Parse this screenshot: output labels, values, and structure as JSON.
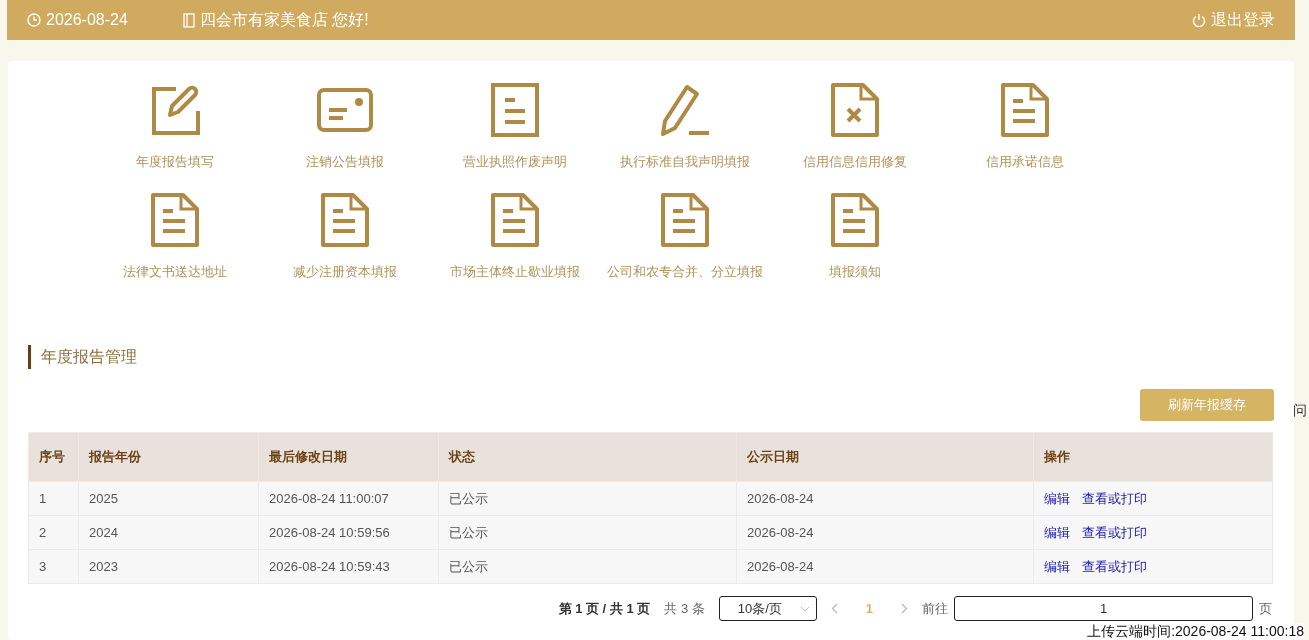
{
  "header": {
    "date": "2026-08-24",
    "greeting": "四会市有家美食店 您好!",
    "logout": "退出登录"
  },
  "shortcuts": [
    {
      "label": "年度报告填写",
      "kind": "edit"
    },
    {
      "label": "注销公告填报",
      "kind": "card"
    },
    {
      "label": "营业执照作废声明",
      "kind": "doc"
    },
    {
      "label": "执行标准自我声明填报",
      "kind": "pencil"
    },
    {
      "label": "信用信息信用修复",
      "kind": "docx"
    },
    {
      "label": "信用承诺信息",
      "kind": "folded"
    },
    {
      "label": "法律文书送达地址",
      "kind": "folded"
    },
    {
      "label": "减少注册资本填报",
      "kind": "folded"
    },
    {
      "label": "市场主体终止歇业填报",
      "kind": "folded"
    },
    {
      "label": "公司和农专合并、分立填报",
      "kind": "folded"
    },
    {
      "label": "填报须知",
      "kind": "folded"
    }
  ],
  "section": {
    "title": "年度报告管理",
    "refresh_button": "刷新年报缓存"
  },
  "table": {
    "columns": [
      "序号",
      "报告年份",
      "最后修改日期",
      "状态",
      "公示日期",
      "操作"
    ],
    "rows": [
      {
        "cells": [
          "1",
          "2025",
          "2026-08-24 11:00:07",
          "已公示",
          "2026-08-24"
        ],
        "actions": [
          "编辑",
          "查看或打印"
        ]
      },
      {
        "cells": [
          "2",
          "2024",
          "2026-08-24 10:59:56",
          "已公示",
          "2026-08-24"
        ],
        "actions": [
          "编辑",
          "查看或打印"
        ]
      },
      {
        "cells": [
          "3",
          "2023",
          "2026-08-24 10:59:43",
          "已公示",
          "2026-08-24"
        ],
        "actions": [
          "编辑",
          "查看或打印"
        ]
      }
    ]
  },
  "pagination": {
    "summary": "第 1 页 / 共 1 页",
    "total": "共 3 条",
    "page_size": "10条/页",
    "pages": [
      {
        "label": "1",
        "selected": true
      }
    ],
    "goto_label": "前往",
    "goto_value": "1",
    "goto_suffix": "页"
  },
  "side_text": "问",
  "upload_time": "上传云端时间:2026-08-24 11:00:18"
}
